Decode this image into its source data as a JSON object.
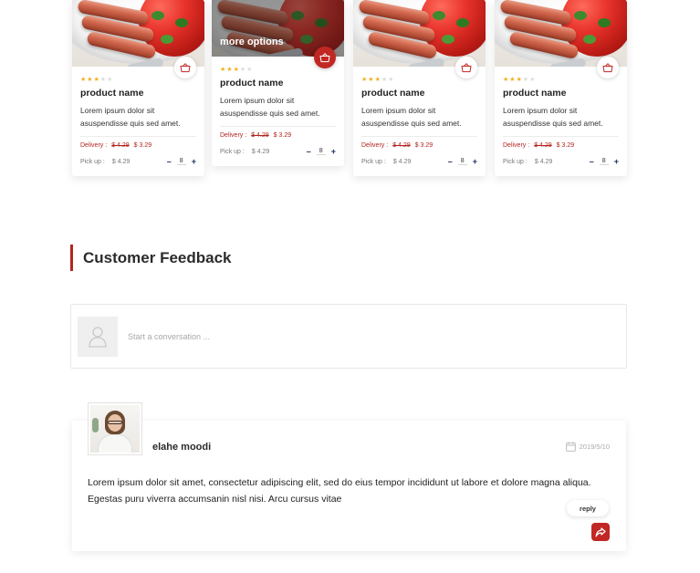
{
  "products": [
    {
      "more_options": "",
      "rating": 3,
      "name": "product name",
      "description": "Lorem ipsum dolor sit asuspendisse quis sed amet.",
      "delivery_label": "Delivery :",
      "old_price": "$ 4.29",
      "new_price": "$ 3.29",
      "pickup_label": "Pick up :",
      "pickup_price": "$ 4.29",
      "quantity": "8",
      "featured": false
    },
    {
      "more_options": "more options",
      "rating": 3,
      "name": "product name",
      "description": "Lorem ipsum dolor sit asuspendisse quis sed amet.",
      "delivery_label": "Delivery :",
      "old_price": "$ 4.29",
      "new_price": "$ 3.29",
      "pickup_label": "Pick up :",
      "pickup_price": "$ 4.29",
      "quantity": "8",
      "featured": true
    },
    {
      "more_options": "",
      "rating": 3,
      "name": "product name",
      "description": "Lorem ipsum dolor sit asuspendisse quis sed amet.",
      "delivery_label": "Delivery :",
      "old_price": "$ 4.29",
      "new_price": "$ 3.29",
      "pickup_label": "Pick up :",
      "pickup_price": "$ 4.29",
      "quantity": "8",
      "featured": false
    },
    {
      "more_options": "",
      "rating": 3,
      "name": "product name",
      "description": "Lorem ipsum dolor sit asuspendisse quis sed amet.",
      "delivery_label": "Delivery :",
      "old_price": "$ 4.29",
      "new_price": "$ 3.29",
      "pickup_label": "Pick up :",
      "pickup_price": "$ 4.29",
      "quantity": "8",
      "featured": false
    }
  ],
  "icons": {
    "cart": "basket-icon",
    "minus": "minus-icon",
    "plus": "plus-icon",
    "star": "star-icon",
    "avatar_placeholder": "user-icon",
    "calendar": "calendar-icon",
    "share": "share-icon"
  },
  "colors": {
    "accent": "#c12824",
    "star": "#f2b01e",
    "star_off": "#dddddd"
  },
  "feedback": {
    "title": "Customer Feedback",
    "composer_placeholder": "Start a conversation ...",
    "comment": {
      "author": "elahe moodi",
      "date": "2019/5/10",
      "text": "Lorem ipsum dolor sit amet, consectetur adipiscing elit, sed do eius   tempor incididunt ut labore et dolore magna aliqua. Egestas puru viverra accumsanin nisl nisi. Arcu cursus vitae",
      "reply_label": "reply"
    }
  }
}
